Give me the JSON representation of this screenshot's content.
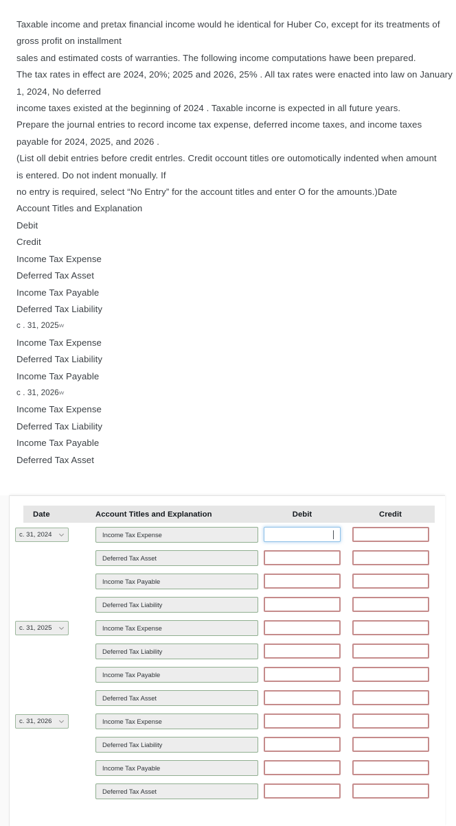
{
  "question": {
    "lines": [
      {
        "text": "Taxable income and pretax financial income would he identical for Huber Co, except for its treatments of",
        "small": false
      },
      {
        "text": "gross profit on installment",
        "small": false
      },
      {
        "text": "sales and estimated costs of warranties. The following income computations hawe been prepared.",
        "small": false
      },
      {
        "text": "The tax rates in effect are 2024, 20%; 2025 and 2026, 25% . All tax rates were enacted into law on January",
        "small": false
      },
      {
        "text": "1, 2024, No deferred",
        "small": false
      },
      {
        "text": "income taxes existed at the beginning of 2024 . Taxable incorne is expected in all future years.",
        "small": false
      },
      {
        "text": "Prepare the journal entries to record income tax expense, deferred income taxes, and income taxes",
        "small": false
      },
      {
        "text": "payable for 2024, 2025, and 2026 .",
        "small": false
      },
      {
        "text": "(List oll debit entries before credit entrles. Credit occount titles ore outomotically indented when amount",
        "small": false
      },
      {
        "text": "is entered. Do not indent monually. If",
        "small": false
      },
      {
        "text": "no entry is required, select “No Entry” for the account titles and enter O for the amounts.)Date",
        "small": false
      },
      {
        "text": "Account Titles and Explanation",
        "small": false
      },
      {
        "text": "Debit",
        "small": false
      },
      {
        "text": "Credit",
        "small": false
      },
      {
        "text": "Income Tax Expense",
        "small": false
      },
      {
        "text": "Deferred Tax Asset",
        "small": false
      },
      {
        "text": "Income Tax Payable",
        "small": false
      },
      {
        "text": "Deferred Tax Liability",
        "small": false
      },
      {
        "text": "c . 31, 2025",
        "small": true,
        "suffix": "vv"
      },
      {
        "text": "Income Tax Expense",
        "small": false
      },
      {
        "text": "Deferred Tax Liability",
        "small": false
      },
      {
        "text": "Income Tax Payable",
        "small": false
      },
      {
        "text": "c . 31, 2026",
        "small": true,
        "suffix": "vv"
      },
      {
        "text": "Income Tax Expense",
        "small": false
      },
      {
        "text": "Deferred Tax Liability",
        "small": false
      },
      {
        "text": "Income Tax Payable",
        "small": false
      },
      {
        "text": "Deferred Tax Asset",
        "small": false
      }
    ]
  },
  "journal_table": {
    "headers": {
      "date": "Date",
      "account": "Account Titles and Explanation",
      "debit": "Debit",
      "credit": "Credit"
    },
    "rows": [
      {
        "date": "c. 31, 2024",
        "account": "Income Tax Expense",
        "debit": "",
        "credit": "",
        "debit_focused": true,
        "debit_error": false,
        "credit_error": true
      },
      {
        "date": "",
        "account": "Deferred Tax Asset",
        "debit": "",
        "credit": "",
        "debit_focused": false,
        "debit_error": true,
        "credit_error": true
      },
      {
        "date": "",
        "account": "Income Tax Payable",
        "debit": "",
        "credit": "",
        "debit_focused": false,
        "debit_error": true,
        "credit_error": true
      },
      {
        "date": "",
        "account": "Deferred Tax Liability",
        "debit": "",
        "credit": "",
        "debit_focused": false,
        "debit_error": true,
        "credit_error": true
      },
      {
        "date": "c. 31, 2025",
        "account": "Income Tax Expense",
        "debit": "",
        "credit": "",
        "debit_focused": false,
        "debit_error": true,
        "credit_error": true
      },
      {
        "date": "",
        "account": "Deferred Tax Liability",
        "debit": "",
        "credit": "",
        "debit_focused": false,
        "debit_error": true,
        "credit_error": true
      },
      {
        "date": "",
        "account": "Income Tax Payable",
        "debit": "",
        "credit": "",
        "debit_focused": false,
        "debit_error": true,
        "credit_error": true
      },
      {
        "date": "",
        "account": "Deferred Tax Asset",
        "debit": "",
        "credit": "",
        "debit_focused": false,
        "debit_error": true,
        "credit_error": true
      },
      {
        "date": "c. 31, 2026",
        "account": "Income Tax Expense",
        "debit": "",
        "credit": "",
        "debit_focused": false,
        "debit_error": true,
        "credit_error": true
      },
      {
        "date": "",
        "account": "Deferred Tax Liability",
        "debit": "",
        "credit": "",
        "debit_focused": false,
        "debit_error": true,
        "credit_error": true
      },
      {
        "date": "",
        "account": "Income Tax Payable",
        "debit": "",
        "credit": "",
        "debit_focused": false,
        "debit_error": true,
        "credit_error": true
      },
      {
        "date": "",
        "account": "Deferred Tax Asset",
        "debit": "",
        "credit": "",
        "debit_focused": false,
        "debit_error": true,
        "credit_error": true
      }
    ]
  },
  "colors": {
    "header_bg": "#e6e6e6",
    "field_bg": "#ededed",
    "field_border_green": "#8fae8f",
    "amount_border_error": "#c58b8b",
    "amount_border_focus": "#8dc0e8",
    "text": "#3a3f44",
    "panel_bg": "#ffffff",
    "rail_bg": "#fafafa"
  },
  "icons": {
    "chevron_down": "chevron-down-icon"
  }
}
